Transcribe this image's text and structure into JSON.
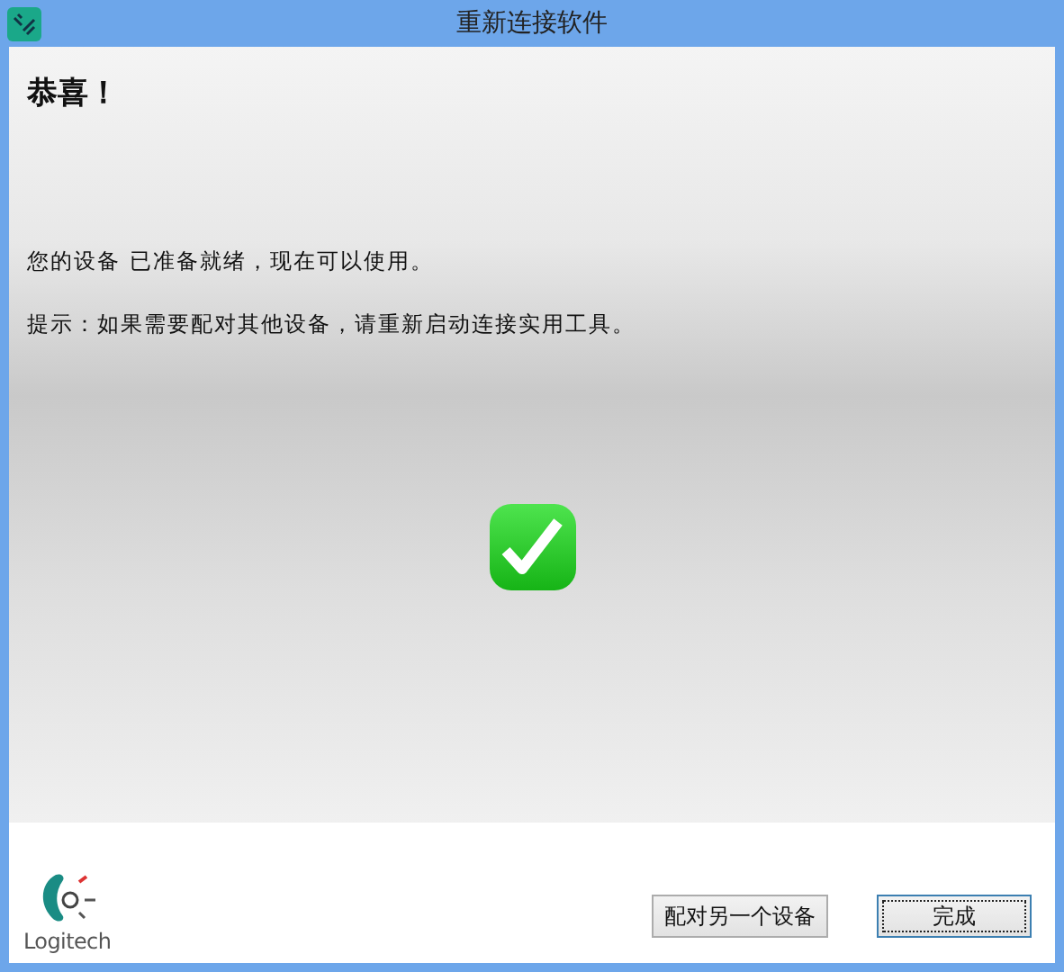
{
  "window": {
    "title": "重新连接软件"
  },
  "heading": "恭喜！",
  "messages": [
    "您的设备 已准备就绪，现在可以使用。",
    "提示：如果需要配对其他设备，请重新启动连接实用工具。"
  ],
  "logo": {
    "text": "Logitech"
  },
  "buttons": [
    {
      "label": "配对另一个设备",
      "default": false
    },
    {
      "label": "完成",
      "default": true
    }
  ]
}
